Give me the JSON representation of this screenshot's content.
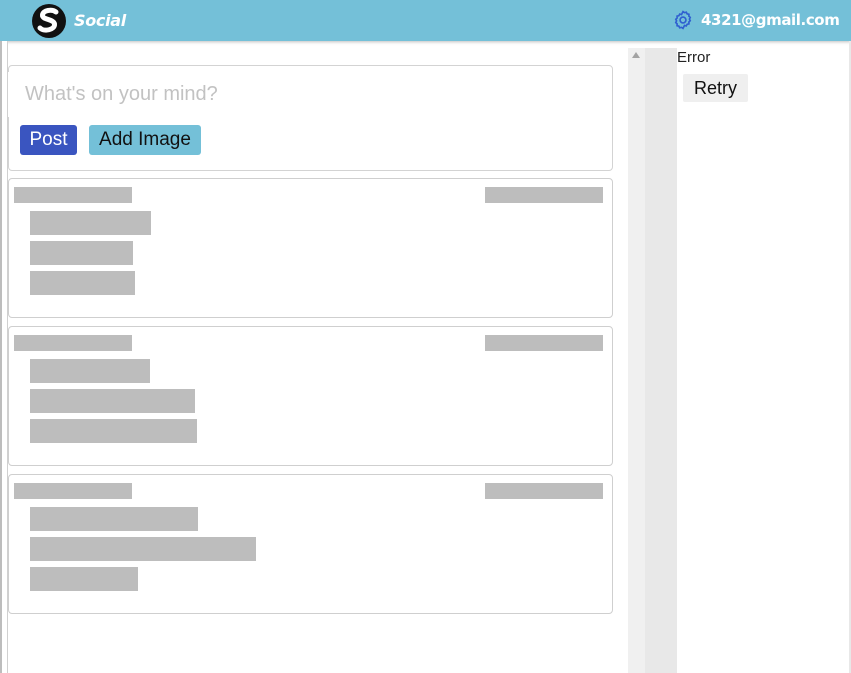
{
  "header": {
    "brand": "Social",
    "account_email": "4321@gmail.com",
    "logo_icon": "social-s-logo",
    "settings_icon": "gear-icon",
    "bar_color": "#74c0d8"
  },
  "composer": {
    "placeholder": "What's on your mind?",
    "post_label": "Post",
    "add_image_label": "Add Image",
    "post_color": "#3a55c0",
    "add_image_color": "#74c0d8"
  },
  "feed": {
    "loading": true,
    "skeleton_cards": 3
  },
  "sidebar": {
    "error_text": "Error",
    "retry_label": "Retry"
  }
}
